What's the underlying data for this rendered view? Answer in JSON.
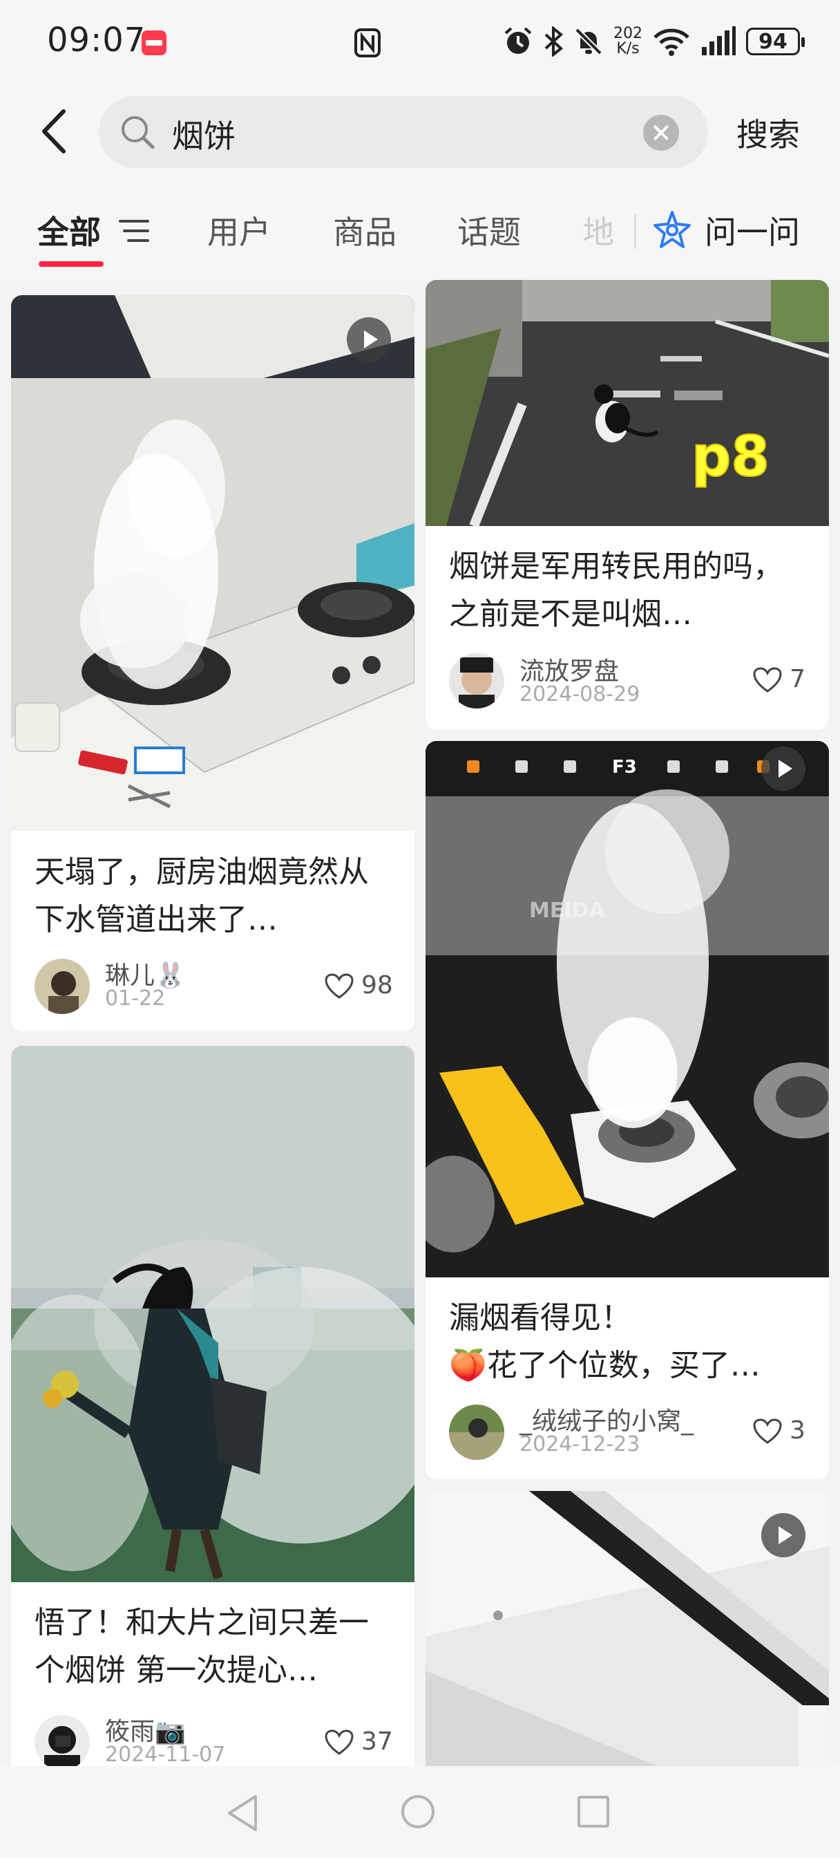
{
  "status_bar": {
    "time": "09:07",
    "net_speed_value": "202",
    "net_speed_unit": "K/s",
    "battery": "94",
    "icons": [
      "app-notification-icon",
      "nfc-icon",
      "alarm-icon",
      "bluetooth-icon",
      "mute-icon",
      "wifi-icon",
      "signal-icon",
      "battery-icon"
    ]
  },
  "header": {
    "search_query": "烟饼",
    "search_button": "搜索",
    "icons": [
      "back-arrow-icon",
      "search-icon",
      "clear-icon"
    ]
  },
  "tabs": {
    "items": [
      "全部",
      "用户",
      "商品",
      "话题",
      "地"
    ],
    "active": "全部",
    "ask_label": "问一问",
    "accent": "#ff2442"
  },
  "feed": {
    "cards": [
      {
        "title": "天塌了，厨房油烟竟然从下水管道出来了…",
        "author": "琳儿🐰",
        "date": "01-22",
        "likes": "98",
        "video": true
      },
      {
        "title": "烟饼是军用转民用的吗，之前是不是叫烟…",
        "author": "流放罗盘",
        "date": "2024-08-29",
        "likes": "7",
        "video": false,
        "image_text": "p8"
      },
      {
        "title": "漏烟看得见！\n🍑花了个位数，买了…",
        "author": "_绒绒子的小窝_",
        "date": "2024-12-23",
        "likes": "3",
        "video": true,
        "image_text": "MEIDA",
        "image_panel": "F3"
      },
      {
        "title": "悟了！和大片之间只差一个烟饼 第一次提心…",
        "author": "筱雨📷",
        "date": "2024-11-07",
        "likes": "37",
        "video": false
      },
      {
        "title": "",
        "author": "",
        "date": "",
        "likes": "",
        "video": true
      }
    ]
  },
  "nav_bar": {
    "icons": [
      "nav-back-icon",
      "nav-home-icon",
      "nav-recents-icon"
    ]
  }
}
